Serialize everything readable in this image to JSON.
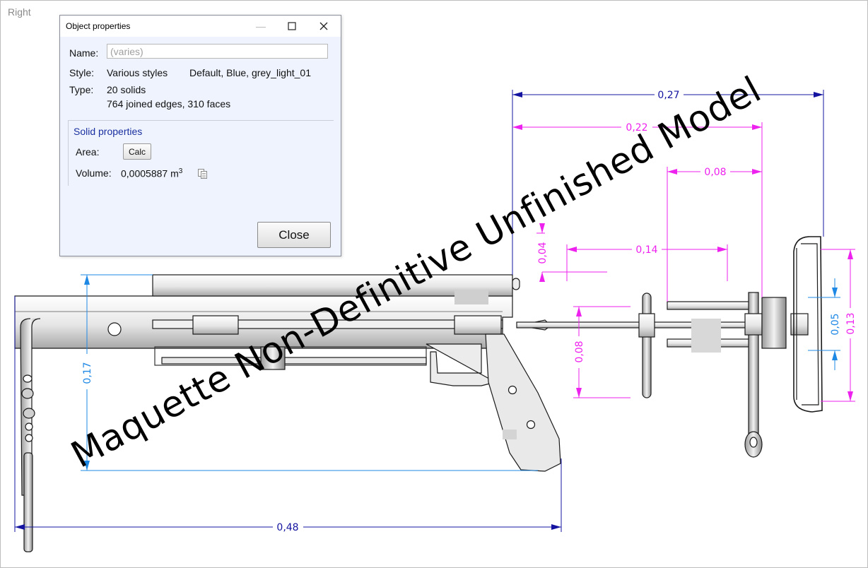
{
  "viewport": {
    "view_name": "Right",
    "watermark": "Maquette Non-Definitive Unfinished Model"
  },
  "dimensions": {
    "overall_length": "0,48",
    "overall_height": "0,17",
    "stock_length": "0,27",
    "stock_inner_length": "0,22",
    "tube_spacing": "0,08",
    "rod_length": "0,14",
    "small_height": "0,04",
    "bracket_height": "0,08",
    "pad_height": "0,13",
    "pad_inner": "0,05"
  },
  "colors": {
    "dimension_primary": "#1414a0",
    "dimension_secondary": "#ee22ee",
    "dimension_vertical": "#1e88e5",
    "model_edge": "#1a1a1a",
    "model_fill": "#e8e8e8"
  },
  "dialog": {
    "title": "Object properties",
    "name_label": "Name:",
    "name_placeholder": "(varies)",
    "style_label": "Style:",
    "style_value": "Various styles",
    "style_list": "Default, Blue, grey_light_01",
    "type_label": "Type:",
    "type_value": "20 solids",
    "type_detail": "764 joined edges, 310 faces",
    "group_title": "Solid properties",
    "area_label": "Area:",
    "calc_label": "Calc",
    "volume_label": "Volume:",
    "volume_value": "0,0005887 m",
    "volume_unit_exp": "3",
    "close_label": "Close",
    "icons": {
      "minimize": "minimize-icon",
      "maximize": "maximize-icon",
      "close": "close-icon",
      "copy": "copy-icon"
    }
  }
}
